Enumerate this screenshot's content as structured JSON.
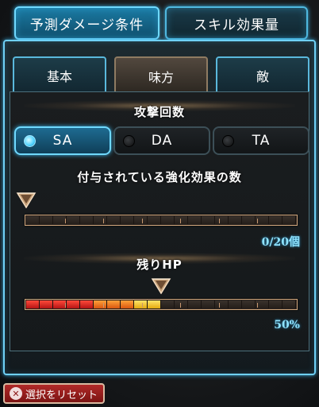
{
  "top_tabs": [
    {
      "label": "予測ダメージ条件",
      "active": true
    },
    {
      "label": "スキル効果量",
      "active": false
    }
  ],
  "sub_tabs": [
    {
      "label": "基本",
      "active": false
    },
    {
      "label": "味方",
      "active": true
    },
    {
      "label": "敵",
      "active": false
    }
  ],
  "attack_count": {
    "title": "攻撃回数",
    "options": [
      {
        "label": "SA",
        "selected": true
      },
      {
        "label": "DA",
        "selected": false
      },
      {
        "label": "TA",
        "selected": false
      }
    ]
  },
  "buffs": {
    "title": "付与されている強化効果の数",
    "current": 0,
    "max": 20,
    "value_text": "0/20個"
  },
  "hp": {
    "title": "残りHP",
    "percent": 50,
    "value_text": "50%"
  },
  "reset_button": {
    "label": "選択をリセット"
  },
  "colors": {
    "accent": "#6fd9ff",
    "value_text": "#8fe3ff",
    "hp_high": "#ffd21a",
    "hp_low": "#d61f1f",
    "reset": "#b12a29"
  }
}
